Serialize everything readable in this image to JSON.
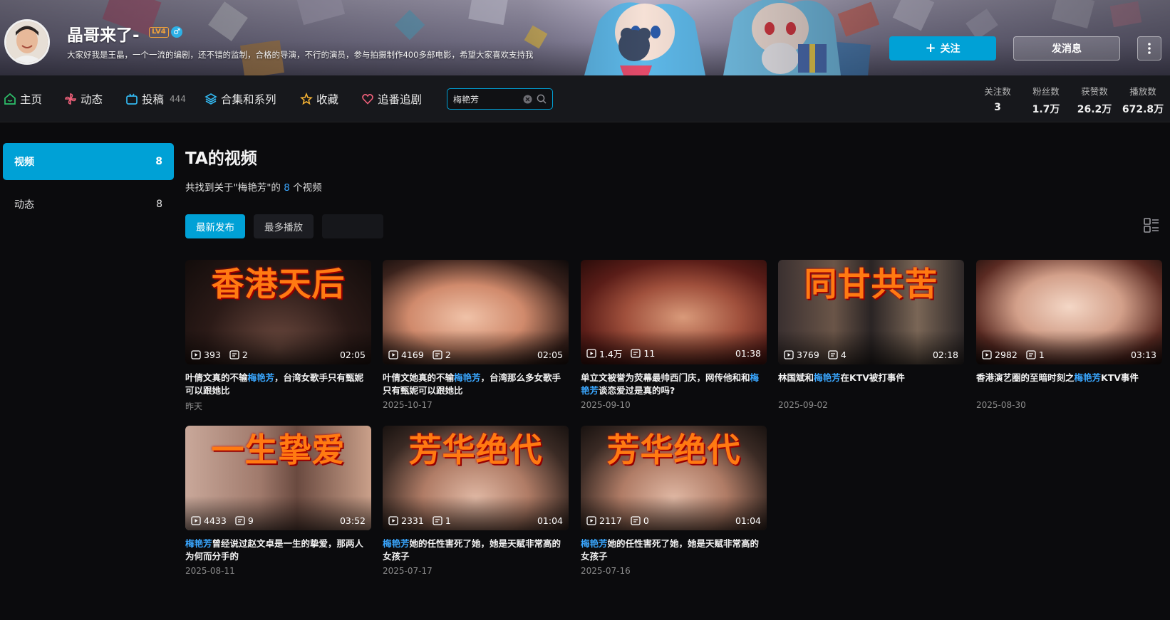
{
  "profile": {
    "name": "晶哥来了-",
    "level": "LV4",
    "gender": "♂",
    "bio": "大家好我是王晶，一个一流的编剧，还不错的监制，合格的导演，不行的演员，参与拍摄制作400多部电影，希望大家喜欢支持我",
    "follow_label": "关注",
    "message_label": "发消息"
  },
  "nav": {
    "items": [
      {
        "label": "主页",
        "icon": "home-icon",
        "color": "#2ec26b"
      },
      {
        "label": "动态",
        "icon": "pinwheel-icon",
        "color": "#f0607a"
      },
      {
        "label": "投稿",
        "icon": "tv-icon",
        "color": "#33b8f0",
        "count": "444"
      },
      {
        "label": "合集和系列",
        "icon": "layers-icon",
        "color": "#33b8f0"
      },
      {
        "label": "收藏",
        "icon": "star-icon",
        "color": "#f5b233"
      },
      {
        "label": "追番追剧",
        "icon": "heart-icon",
        "color": "#f0607a"
      }
    ],
    "search_value": "梅艳芳",
    "stats": [
      {
        "label": "关注数",
        "value": "3"
      },
      {
        "label": "粉丝数",
        "value": "1.7万"
      },
      {
        "label": "获赞数",
        "value": "26.2万"
      },
      {
        "label": "播放数",
        "value": "672.8万"
      }
    ]
  },
  "sidebar": {
    "items": [
      {
        "label": "视频",
        "count": "8"
      },
      {
        "label": "动态",
        "count": "8"
      }
    ]
  },
  "main": {
    "title": "TA的视频",
    "result_prefix": "共找到关于\"梅艳芳\"的 ",
    "result_count": "8",
    "result_suffix": " 个视频",
    "filters": [
      "最新发布",
      "最多播放"
    ],
    "videos": [
      {
        "art": "香港天后",
        "views": "393",
        "danmaku": "2",
        "duration": "02:05",
        "title_pre": "叶倩文真的不输",
        "kw": "梅艳芳",
        "title_post": "，台湾女歌手只有甄妮可以跟她比",
        "date": "昨天"
      },
      {
        "art": "",
        "views": "4169",
        "danmaku": "2",
        "duration": "02:05",
        "title_pre": "叶倩文她真的不输",
        "kw": "梅艳芳",
        "title_post": "，台湾那么多女歌手只有甄妮可以跟她比",
        "date": "2025-10-17"
      },
      {
        "art": "",
        "views": "1.4万",
        "danmaku": "11",
        "duration": "01:38",
        "title_pre": "单立文被誉为荧幕最帅西门庆，网传他和和",
        "kw": "梅艳芳",
        "title_post": "谈恋爱过是真的吗?",
        "date": "2025-09-10"
      },
      {
        "art": "同甘共苦",
        "views": "3769",
        "danmaku": "4",
        "duration": "02:18",
        "title_pre": "林国斌和",
        "kw": "梅艳芳",
        "title_post": "在KTV被打事件",
        "date": "2025-09-02"
      },
      {
        "art": "",
        "views": "2982",
        "danmaku": "1",
        "duration": "03:13",
        "title_pre": "香港演艺圈的至暗时刻之",
        "kw": "梅艳芳",
        "title_post": "KTV事件",
        "date": "2025-08-30"
      },
      {
        "art": "一生挚爱",
        "views": "4433",
        "danmaku": "9",
        "duration": "03:52",
        "title_pre": "",
        "kw": "梅艳芳",
        "title_post": "曾经说过赵文卓是一生的挚爱，那两人为何而分手的",
        "date": "2025-08-11"
      },
      {
        "art": "芳华绝代",
        "views": "2331",
        "danmaku": "1",
        "duration": "01:04",
        "title_pre": "",
        "kw": "梅艳芳",
        "title_post": "她的任性害死了她，她是天赋非常高的女孩子",
        "date": "2025-07-17"
      },
      {
        "art": "芳华绝代",
        "views": "2117",
        "danmaku": "0",
        "duration": "01:04",
        "title_pre": "",
        "kw": "梅艳芳",
        "title_post": "她的任性害死了她，她是天赋非常高的女孩子",
        "date": "2025-07-16"
      }
    ]
  }
}
